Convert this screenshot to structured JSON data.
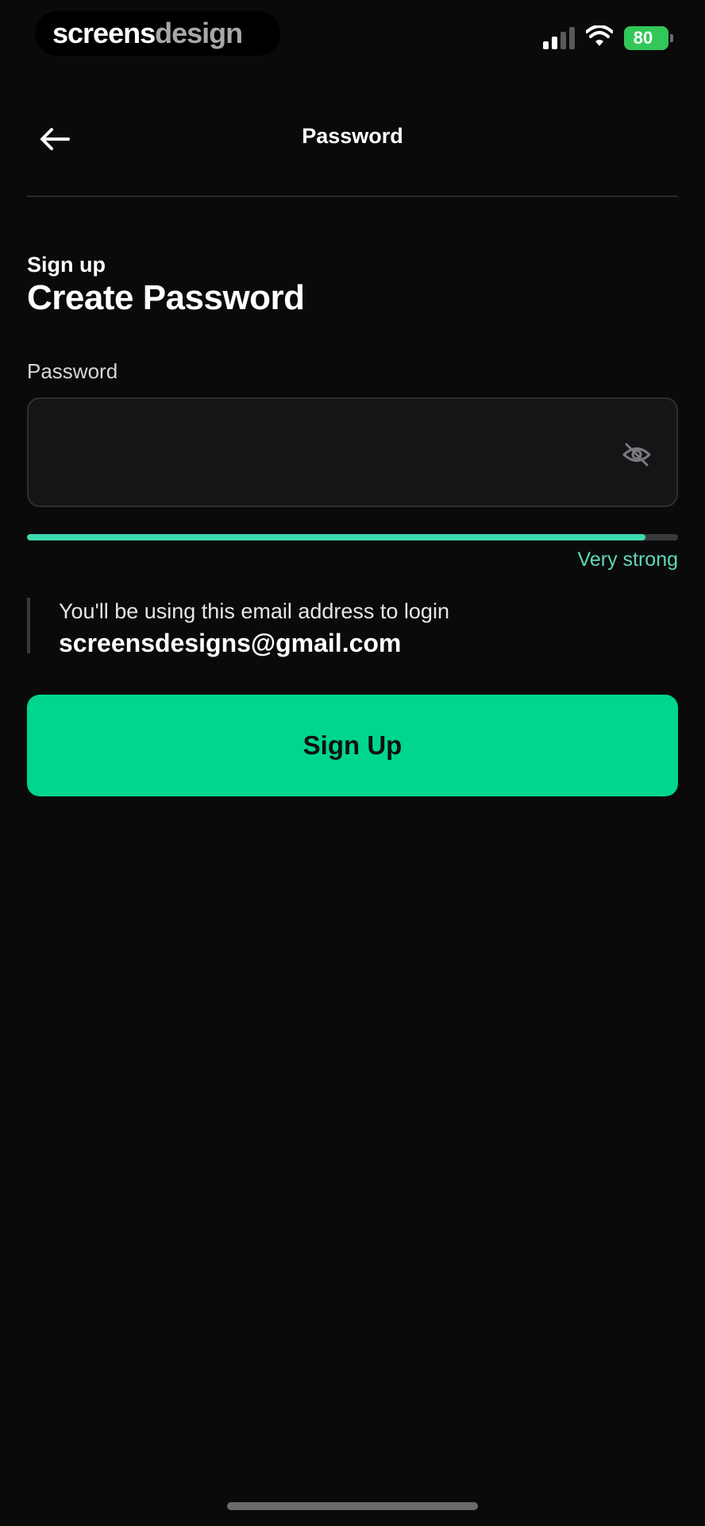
{
  "status_bar": {
    "brand_part_1": "screens",
    "brand_part_2": "design",
    "battery_level": "80",
    "signal_bars_active": 2,
    "signal_bars_total": 4,
    "icons": [
      "signal-icon",
      "wifi-icon",
      "battery-icon"
    ],
    "battery_color": "#33c759"
  },
  "header": {
    "title": "Password",
    "back_icon": "arrow-left-icon"
  },
  "form": {
    "eyebrow": "Sign up",
    "title": "Create Password",
    "password_label": "Password",
    "password_value": "",
    "visibility_icon": "eye-off-icon",
    "strength_fraction": 0.95,
    "strength_label": "Very strong",
    "strength_color": "#3fd9b0"
  },
  "email_note": {
    "text": "You'll be using this email address to login",
    "email": "screensdesigns@gmail.com"
  },
  "actions": {
    "signup_label": "Sign Up",
    "accent_color": "#00d68f"
  }
}
